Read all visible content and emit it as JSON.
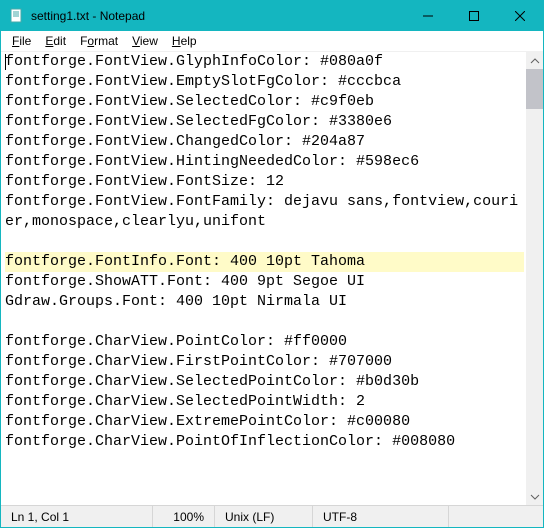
{
  "window": {
    "title": "setting1.txt - Notepad"
  },
  "menu": {
    "file": "File",
    "edit": "Edit",
    "format": "Format",
    "view": "View",
    "help": "Help"
  },
  "content": {
    "lines": [
      "fontforge.FontView.GlyphInfoColor: #080a0f",
      "fontforge.FontView.EmptySlotFgColor: #cccbca",
      "fontforge.FontView.SelectedColor: #c9f0eb",
      "fontforge.FontView.SelectedFgColor: #3380e6",
      "fontforge.FontView.ChangedColor: #204a87",
      "fontforge.FontView.HintingNeededColor: #598ec6",
      "fontforge.FontView.FontSize: 12",
      "fontforge.FontView.FontFamily: dejavu sans,fontview,courier,monospace,clearlyu,unifont",
      "",
      "fontforge.FontInfo.Font: 400 10pt Tahoma",
      "fontforge.ShowATT.Font: 400 9pt Segoe UI",
      "Gdraw.Groups.Font: 400 10pt Nirmala UI",
      "",
      "fontforge.CharView.PointColor: #ff0000",
      "fontforge.CharView.FirstPointColor: #707000",
      "fontforge.CharView.SelectedPointColor: #b0d30b",
      "fontforge.CharView.SelectedPointWidth: 2",
      "fontforge.CharView.ExtremePointColor: #c00080",
      "fontforge.CharView.PointOfInflectionColor: #008080"
    ],
    "highlight_index": 9
  },
  "status": {
    "position": "Ln 1, Col 1",
    "zoom": "100%",
    "eol": "Unix (LF)",
    "encoding": "UTF-8"
  }
}
